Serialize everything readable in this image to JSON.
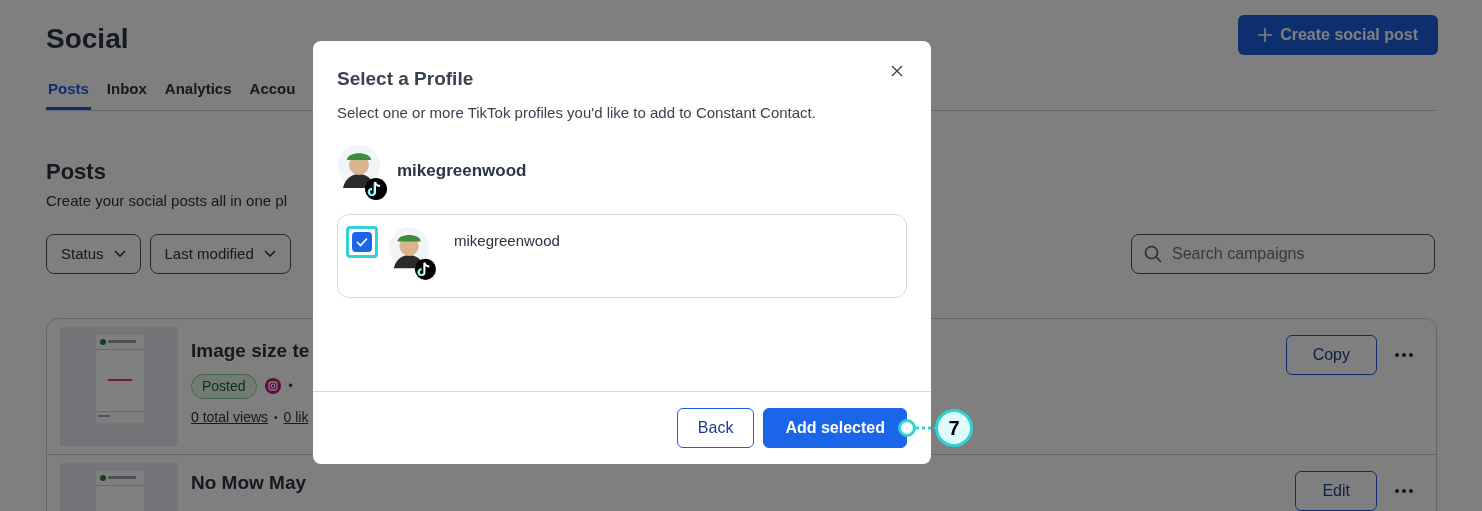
{
  "page": {
    "title": "Social",
    "create_button": "Create social post"
  },
  "tabs": [
    {
      "label": "Posts",
      "selected": true
    },
    {
      "label": "Inbox",
      "selected": false
    },
    {
      "label": "Analytics",
      "selected": false
    },
    {
      "label": "Accou",
      "selected": false
    }
  ],
  "section": {
    "title": "Posts",
    "subtitle": "Create your social posts all in one pl"
  },
  "filters": [
    "Status",
    "Last modified"
  ],
  "search": {
    "placeholder": "Search campaigns"
  },
  "posts": [
    {
      "title": "Image size te",
      "status": "Posted",
      "separator": "•",
      "stats": [
        "0 total views",
        "•",
        "0 lik"
      ],
      "action": "Copy",
      "thumbnail": {
        "kind": "picture"
      }
    },
    {
      "title": "No Mow May",
      "action": "Edit",
      "thumbnail": {
        "kind": "picture"
      }
    }
  ],
  "dialog": {
    "title": "Select a Profile",
    "description": "Select one or more TikTok profiles you'd like to add to Constant Contact.",
    "account": "mikegreenwood",
    "profiles": [
      {
        "name": "mikegreenwood",
        "checked": true
      }
    ],
    "buttons": [
      {
        "label": "Back",
        "kind": "secondary"
      },
      {
        "label": "Add selected",
        "kind": "primary"
      }
    ]
  },
  "callout": {
    "number": "7"
  }
}
